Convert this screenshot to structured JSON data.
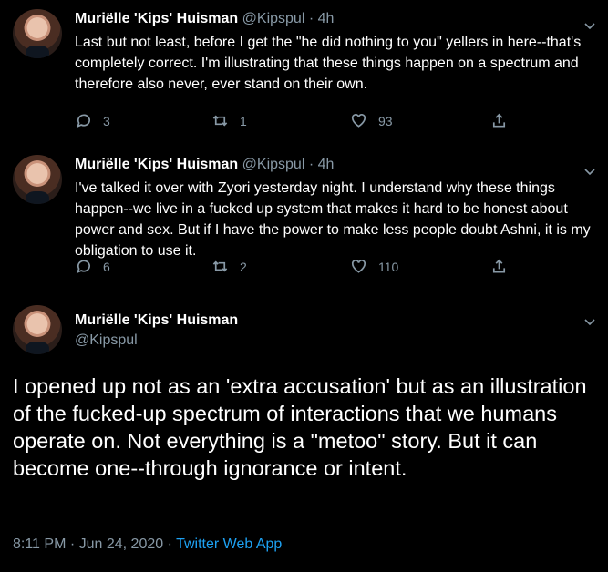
{
  "tweets": [
    {
      "display_name": "Muriëlle 'Kips' Huisman",
      "handle": "@Kipspul",
      "time": "4h",
      "text": "Last but not least, before I get the \"he did nothing to you\" yellers in here--that's completely correct. I'm illustrating that these things happen on a spectrum and therefore also never, ever stand on their own.",
      "replies": "3",
      "retweets": "1",
      "likes": "93"
    },
    {
      "display_name": "Muriëlle 'Kips' Huisman",
      "handle": "@Kipspul",
      "time": "4h",
      "text": "I've talked it over with Zyori yesterday night. I understand why these things happen--we live in a fucked up system that makes it hard to be honest about power and sex. But if I have the power to make less people doubt Ashni, it is my obligation to use it.",
      "replies": "6",
      "retweets": "2",
      "likes": "110"
    }
  ],
  "main_tweet": {
    "display_name": "Muriëlle 'Kips' Huisman",
    "handle": "@Kipspul",
    "text": "I opened up not as an 'extra accusation' but as an illustration of the fucked-up spectrum of interactions that we humans operate on. Not everything is a \"metoo\" story. But it can become one--through ignorance or intent.",
    "timestamp": "8:11 PM · Jun 24, 2020 · ",
    "source": "Twitter Web App"
  },
  "separator": " · ",
  "icons": [
    "reply-icon",
    "retweet-icon",
    "like-icon",
    "share-icon",
    "chevron-down-icon"
  ],
  "colors": {
    "background": "#000000",
    "text": "#ffffff",
    "muted": "#8899a6",
    "link": "#1da1f2"
  }
}
